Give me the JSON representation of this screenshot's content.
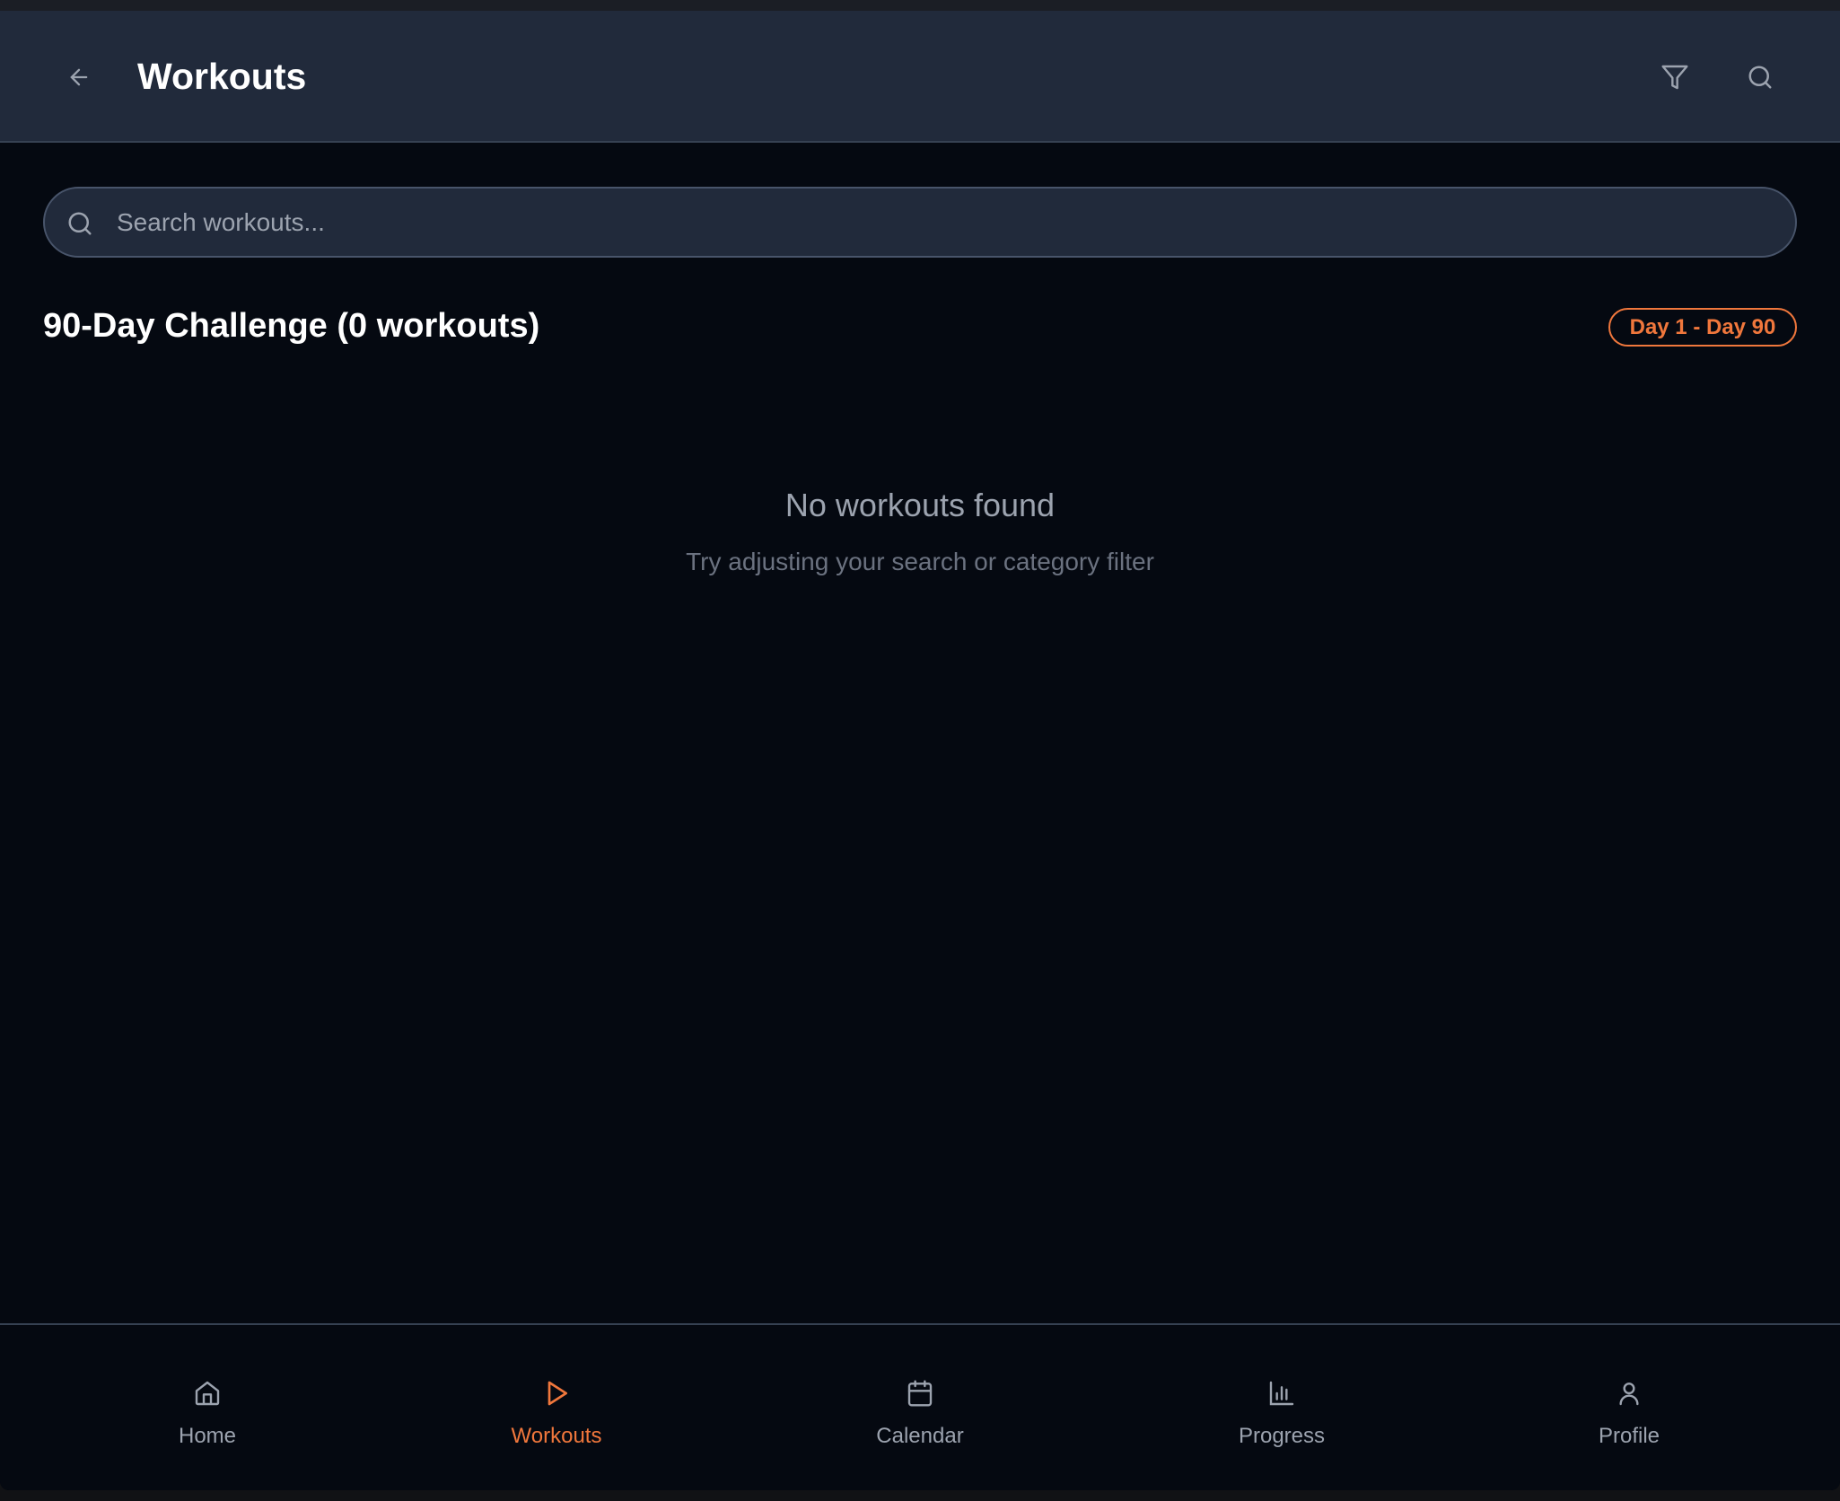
{
  "header": {
    "title": "Workouts",
    "back_icon": "arrow-left-icon",
    "filter_icon": "filter-icon",
    "search_icon": "search-icon"
  },
  "search": {
    "placeholder": "Search workouts...",
    "value": ""
  },
  "section": {
    "title": "90-Day Challenge (0 workouts)",
    "badge": "Day 1 - Day 90"
  },
  "empty": {
    "title": "No workouts found",
    "subtitle": "Try adjusting your search or category filter"
  },
  "nav": {
    "items": [
      {
        "label": "Home",
        "icon": "home-icon"
      },
      {
        "label": "Workouts",
        "icon": "play-icon",
        "active": true
      },
      {
        "label": "Calendar",
        "icon": "calendar-icon"
      },
      {
        "label": "Progress",
        "icon": "bar-chart-icon"
      },
      {
        "label": "Profile",
        "icon": "user-icon"
      }
    ]
  },
  "colors": {
    "accent": "#f0773c",
    "header": "#212a3b",
    "background": "#050911"
  }
}
